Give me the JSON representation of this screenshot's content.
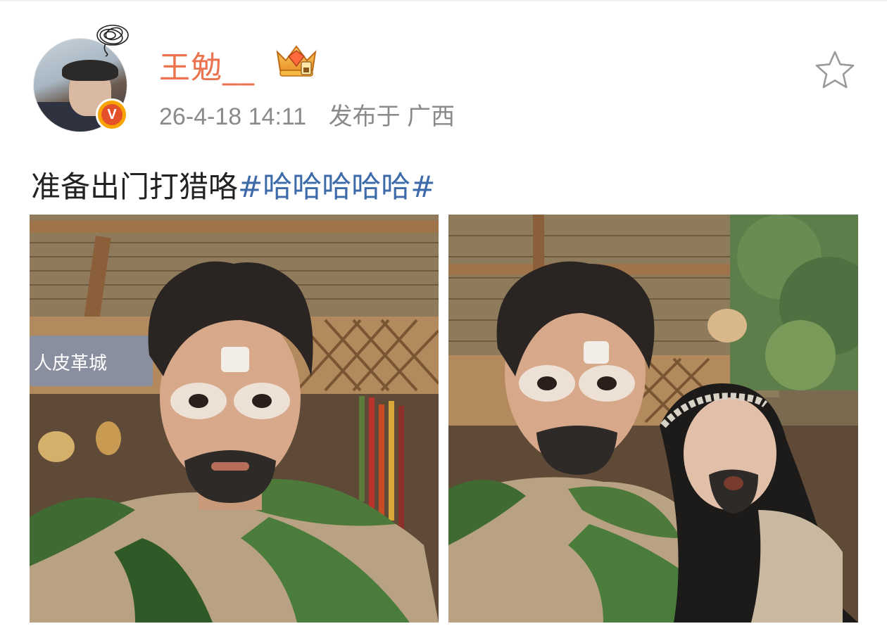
{
  "post": {
    "username": "王勉__",
    "timestamp": "26-4-18 14:11",
    "location_prefix": "发布于",
    "location": "广西",
    "text": "准备出门打猎咯",
    "hashtag": "#哈哈哈哈哈#",
    "verified_badge": "V"
  },
  "icons": {
    "star": "star-outline-icon",
    "crown": "crown-badge-icon",
    "verified": "verified-v-icon"
  },
  "images": [
    {
      "name": "photo-1",
      "sign_text": "人皮革城"
    },
    {
      "name": "photo-2"
    }
  ],
  "colors": {
    "username": "#eb7350",
    "hashtag": "#3d6aa8",
    "meta": "#8a8a8a",
    "badge_outer": "#f7a400",
    "badge_inner": "#e4502a"
  }
}
